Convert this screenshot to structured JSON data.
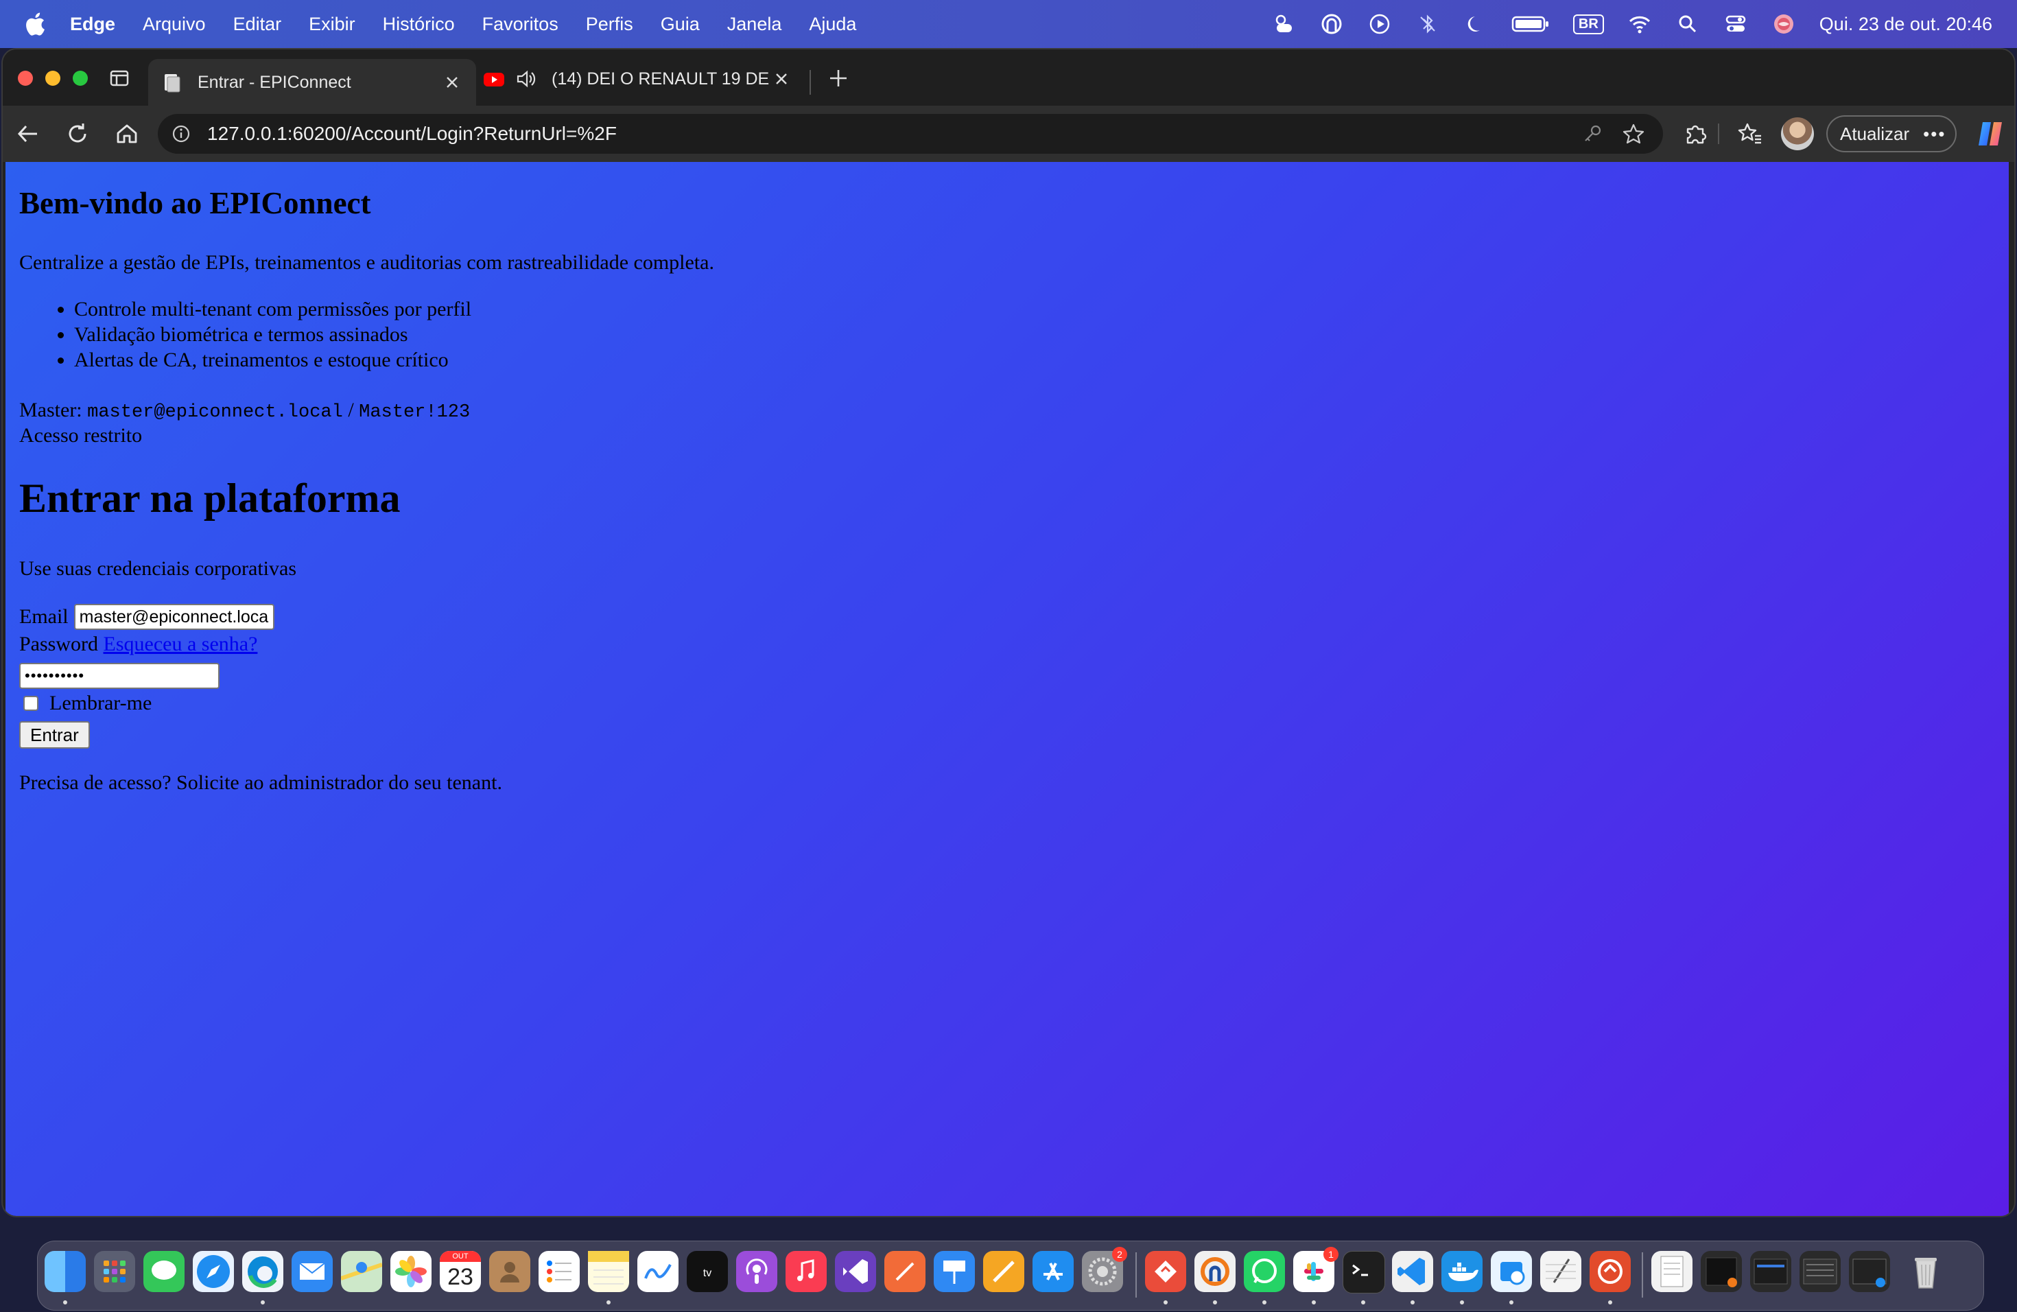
{
  "menubar": {
    "app_name": "Edge",
    "items": [
      "Arquivo",
      "Editar",
      "Exibir",
      "Histórico",
      "Favoritos",
      "Perfis",
      "Guia",
      "Janela",
      "Ajuda"
    ],
    "input_source": "BR",
    "clock": "Qui. 23 de out.  20:46"
  },
  "tabs": [
    {
      "title": "Entrar - EPIConnect",
      "active": true
    },
    {
      "title": "(14) DEI O RENAULT 19 DE",
      "active": false,
      "audio": true
    }
  ],
  "toolbar": {
    "url": "127.0.0.1:60200/Account/Login?ReturnUrl=%2F",
    "update_label": "Atualizar"
  },
  "page": {
    "hero_title": "Bem-vindo ao EPIConnect",
    "hero_desc": "Centralize a gestão de EPIs, treinamentos e auditorias com rastreabilidade completa.",
    "features": [
      "Controle multi-tenant com permissões por perfil",
      "Validação biométrica e termos assinados",
      "Alertas de CA, treinamentos e estoque crítico"
    ],
    "master_label": "Master:",
    "master_email": "master@epiconnect.local",
    "master_sep": "/",
    "master_password": "Master!123",
    "restricted": "Acesso restrito",
    "login_title": "Entrar na plataforma",
    "login_sub": "Use suas credenciais corporativas",
    "email_label": "Email",
    "email_value": "master@epiconnect.local",
    "password_label": "Password",
    "forgot_link": "Esqueceu a senha?",
    "password_mask": "••••••••••",
    "remember_label": "Lembrar-me",
    "submit_label": "Entrar",
    "access_note": "Precisa de acesso? Solicite ao administrador do seu tenant."
  },
  "dock": {
    "calendar_month": "OUT",
    "calendar_day": "23",
    "settings_badge": "2",
    "slack_badge": "1"
  }
}
